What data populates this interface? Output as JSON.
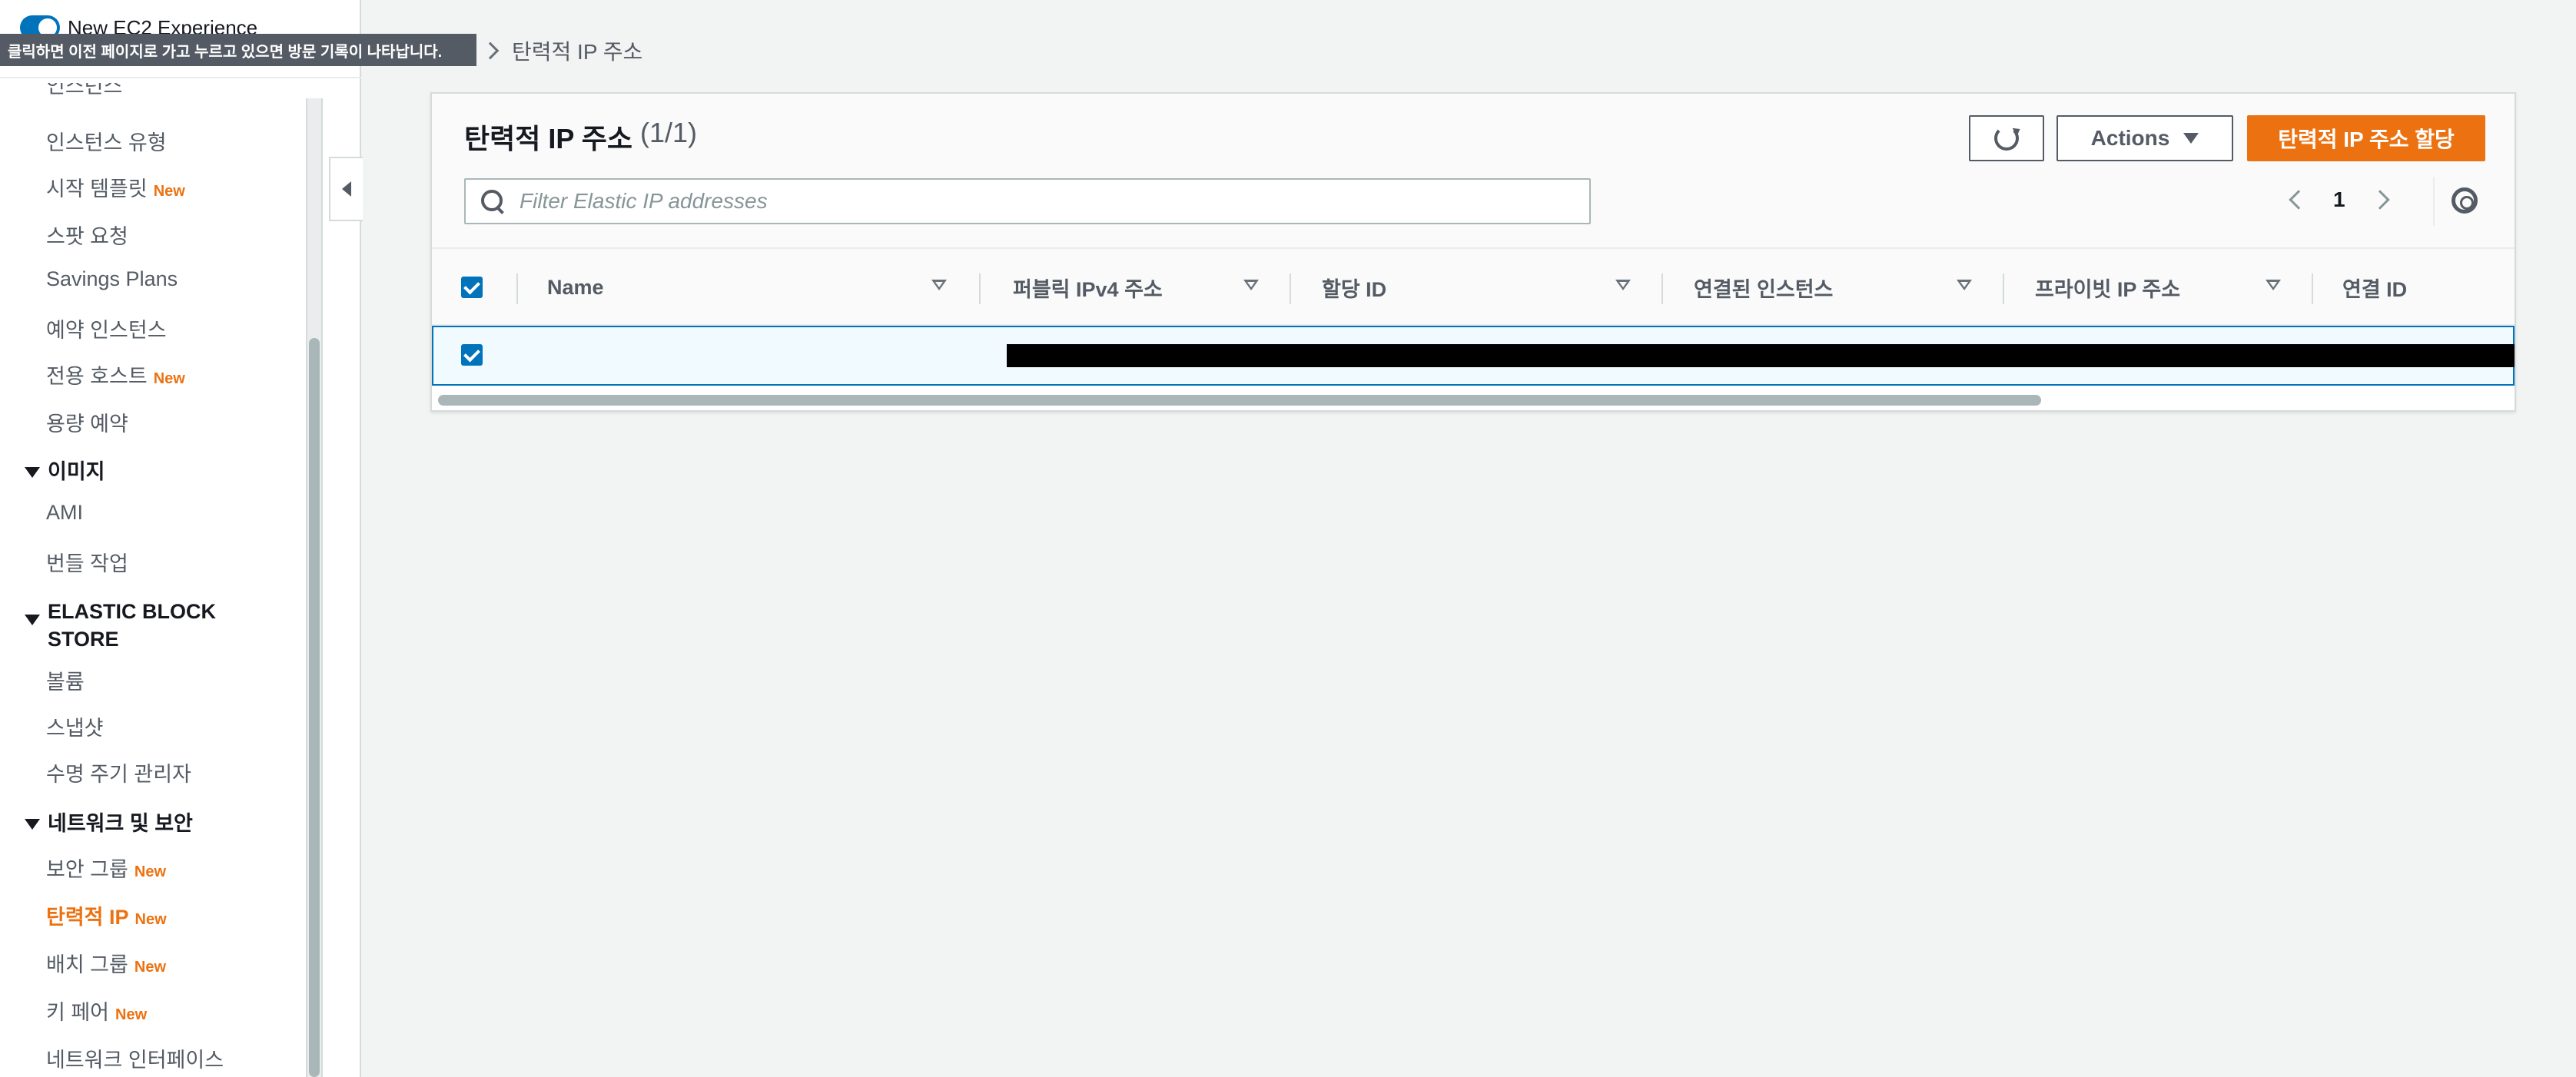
{
  "experience_toggle": {
    "label": "New EC2 Experience",
    "on": true
  },
  "tooltip": {
    "text": "클릭하면 이전 페이지로 가고 누르고 있으면 방문 기록이 나타납니다."
  },
  "breadcrumb": {
    "current": "탄력적 IP 주소"
  },
  "sidebar": {
    "partial_top_item": "인스턴스",
    "items_instances": [
      {
        "label": "인스턴스 유형",
        "badge": ""
      },
      {
        "label": "시작 템플릿",
        "badge": "New"
      },
      {
        "label": "스팟 요청",
        "badge": ""
      },
      {
        "label": "Savings Plans",
        "badge": ""
      },
      {
        "label": "예약 인스턴스",
        "badge": ""
      },
      {
        "label": "전용 호스트",
        "badge": "New"
      },
      {
        "label": "용량 예약",
        "badge": ""
      }
    ],
    "section_images": "이미지",
    "items_images": [
      {
        "label": "AMI"
      },
      {
        "label": "번들 작업"
      }
    ],
    "section_ebs_line1": "ELASTIC BLOCK",
    "section_ebs_line2": "STORE",
    "items_ebs": [
      {
        "label": "볼륨"
      },
      {
        "label": "스냅샷"
      },
      {
        "label": "수명 주기 관리자"
      }
    ],
    "section_network": "네트워크 및 보안",
    "items_network": [
      {
        "label": "보안 그룹",
        "badge": "New",
        "active": false
      },
      {
        "label": "탄력적 IP",
        "badge": "New",
        "active": true
      },
      {
        "label": "배치 그룹",
        "badge": "New",
        "active": false
      },
      {
        "label": "키 페어",
        "badge": "New",
        "active": false
      },
      {
        "label": "네트워크 인터페이스",
        "badge": "",
        "active": false
      }
    ]
  },
  "panel": {
    "title": "탄력적 IP 주소",
    "count": "(1/1)",
    "actions_label": "Actions",
    "primary_label": "탄력적 IP 주소 할당",
    "search_placeholder": "Filter Elastic IP addresses",
    "page_number": "1"
  },
  "table": {
    "columns": [
      "Name",
      "퍼블릭 IPv4 주소",
      "할당 ID",
      "연결된 인스턴스",
      "프라이빗 IP 주소",
      "연결 ID"
    ],
    "rows": [
      {
        "selected": true,
        "name": "",
        "redacted": true
      }
    ]
  },
  "colors": {
    "accent": "#ec7211",
    "selection": "#0073bb",
    "background": "#f2f3f3"
  }
}
